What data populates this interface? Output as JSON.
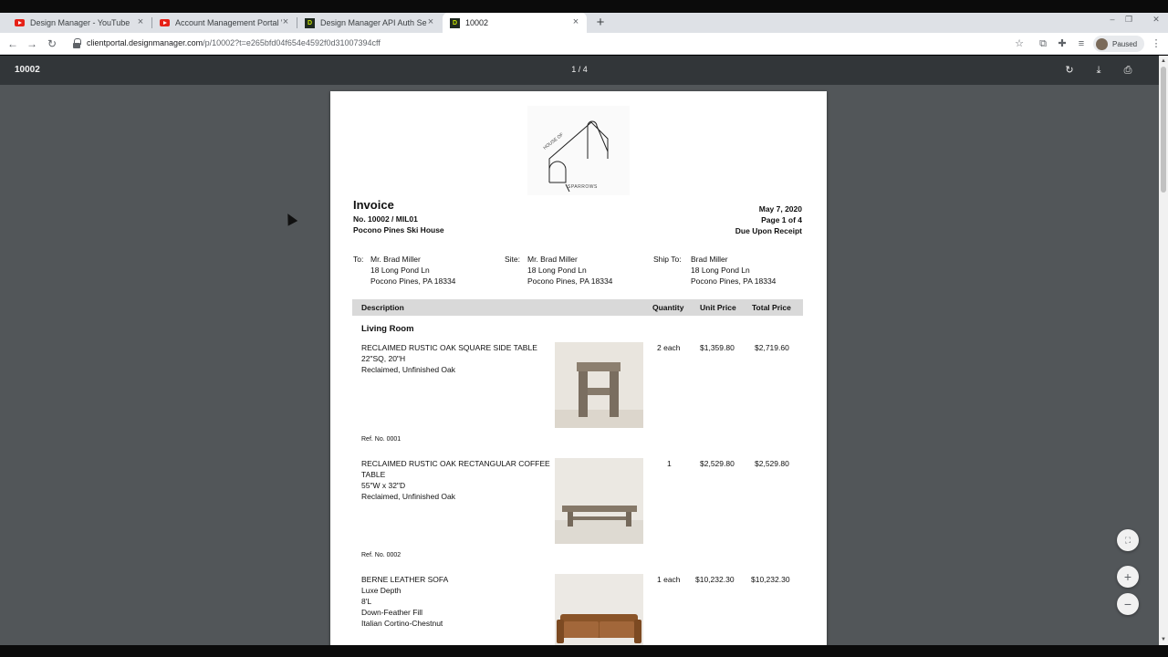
{
  "browser": {
    "tabs": [
      {
        "title": "Design Manager - YouTube",
        "icon": "youtube-icon"
      },
      {
        "title": "Account Management Portal We",
        "icon": "youtube-icon"
      },
      {
        "title": "Design Manager API Auth Server",
        "icon": "design-manager-icon"
      },
      {
        "title": "10002",
        "icon": "design-manager-icon",
        "active": true
      }
    ],
    "url_host": "clientportal.designmanager.com",
    "url_path": "/p/10002?t=e265bfd04f654e4592f0d31007394cff",
    "profile_label": "Paused"
  },
  "pdf": {
    "title": "10002",
    "page_indicator": "1 / 4"
  },
  "invoice": {
    "logo_text_side": "HOUSE OF",
    "logo_text_bottom": "SPARROWS",
    "title": "Invoice",
    "number": "No. 10002 / MIL01",
    "project": "Pocono Pines Ski House",
    "date": "May 7, 2020",
    "page": "Page 1 of 4",
    "terms": "Due Upon Receipt",
    "to": {
      "label": "To:",
      "lines": [
        "Mr. Brad Miller",
        "18 Long Pond Ln",
        "Pocono Pines, PA  18334"
      ]
    },
    "site": {
      "label": "Site:",
      "lines": [
        "Mr. Brad Miller",
        "18 Long Pond Ln",
        "Pocono Pines, PA  18334"
      ]
    },
    "ship_to": {
      "label": "Ship To:",
      "lines": [
        "Brad Miller",
        "18 Long Pond Ln",
        "Pocono Pines, PA  18334"
      ]
    },
    "columns": {
      "description": "Description",
      "quantity": "Quantity",
      "unit_price": "Unit Price",
      "total_price": "Total Price"
    },
    "section": "Living Room",
    "items": [
      {
        "lines": [
          "RECLAIMED RUSTIC OAK SQUARE SIDE TABLE",
          "22\"SQ, 20\"H",
          "Reclaimed, Unfinished Oak"
        ],
        "quantity": "2 each",
        "unit_price": "$1,359.80",
        "total_price": "$2,719.60",
        "ref": "Ref. No. 0001"
      },
      {
        "lines": [
          "RECLAIMED RUSTIC OAK RECTANGULAR COFFEE",
          "TABLE",
          "55\"W x 32\"D",
          "Reclaimed, Unfinished Oak"
        ],
        "quantity": "1",
        "unit_price": "$2,529.80",
        "total_price": "$2,529.80",
        "ref": "Ref. No. 0002"
      },
      {
        "lines": [
          "BERNE LEATHER SOFA",
          "Luxe Depth",
          "8'L",
          "Down-Feather Fill",
          "Italian Cortino-Chestnut"
        ],
        "quantity": "1 each",
        "unit_price": "$10,232.30",
        "total_price": "$10,232.30"
      }
    ]
  }
}
